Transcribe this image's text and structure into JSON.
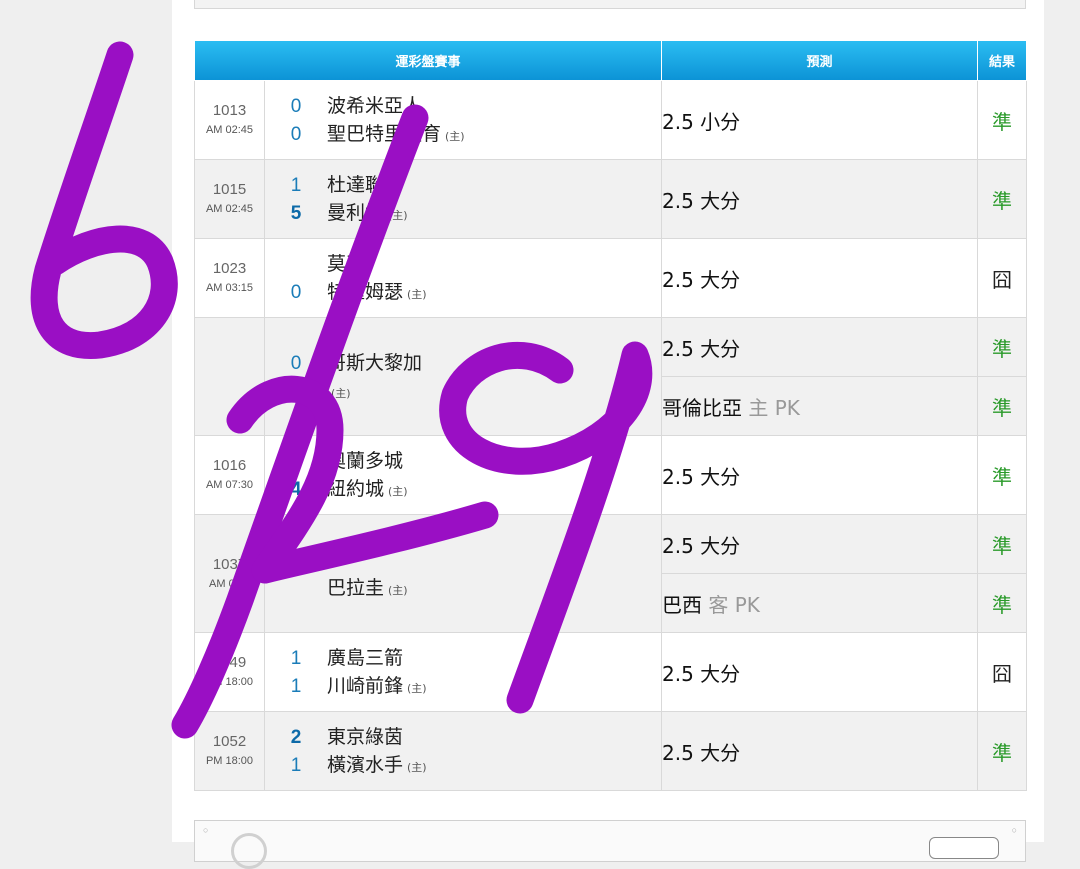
{
  "header": {
    "col_match": "運彩盤賽事",
    "col_pred": "預測",
    "col_result": "結果"
  },
  "home_marker": "(主)",
  "handwritten_date": "6/29",
  "rows": [
    {
      "id": "1013",
      "time": "AM 02:45",
      "away_score": "0",
      "home_score": "0",
      "away": "波希米亞人",
      "home": "聖巴特里體育",
      "preds": [
        {
          "text": "2.5 小分",
          "suffix": "",
          "result": "準"
        }
      ]
    },
    {
      "id": "1015",
      "time": "AM 02:45",
      "away_score": "1",
      "home_score": "5",
      "away": "杜達聯",
      "home": "曼利城",
      "preds": [
        {
          "text": "2.5 大分",
          "suffix": "",
          "result": "準"
        }
      ]
    },
    {
      "id": "1023",
      "time": "AM 03:15",
      "away_score": "",
      "home_score": "0",
      "away": "莫迪",
      "home": "特羅姆瑟",
      "preds": [
        {
          "text": "2.5 大分",
          "suffix": "",
          "result": "囧"
        }
      ]
    },
    {
      "id": "",
      "time": "",
      "away_score": "0",
      "home_score": "",
      "away": "哥斯大黎加",
      "home": "",
      "preds": [
        {
          "text": "2.5 大分",
          "suffix": "",
          "result": "準"
        },
        {
          "text": "哥倫比亞",
          "suffix": "主 PK",
          "result": "準"
        }
      ]
    },
    {
      "id": "1016",
      "time": "AM 07:30",
      "away_score": "2",
      "home_score": "4",
      "away": "奧蘭多城",
      "home": "紐約城",
      "preds": [
        {
          "text": "2.5 大分",
          "suffix": "",
          "result": "準"
        }
      ]
    },
    {
      "id": "1037",
      "time": "AM 09:0",
      "away_score": "",
      "home_score": "",
      "away": "",
      "home": "巴拉圭",
      "preds": [
        {
          "text": "2.5 大分",
          "suffix": "",
          "result": "準"
        },
        {
          "text": "巴西",
          "suffix": "客 PK",
          "result": "準"
        }
      ]
    },
    {
      "id": "1049",
      "time": "PM 18:00",
      "away_score": "1",
      "home_score": "1",
      "away": "廣島三箭",
      "home": "川崎前鋒",
      "preds": [
        {
          "text": "2.5 大分",
          "suffix": "",
          "result": "囧"
        }
      ]
    },
    {
      "id": "1052",
      "time": "PM 18:00",
      "away_score": "2",
      "home_score": "1",
      "away": "東京綠茵",
      "home": "橫濱水手",
      "preds": [
        {
          "text": "2.5 大分",
          "suffix": "",
          "result": "準"
        }
      ]
    }
  ],
  "colors": {
    "header_top": "#2bbdf2",
    "header_bottom": "#0c93d6",
    "hit": "#2a9a2a",
    "miss": "#222222",
    "score": "#1a7cb8",
    "ink": "#9a0fc4"
  }
}
